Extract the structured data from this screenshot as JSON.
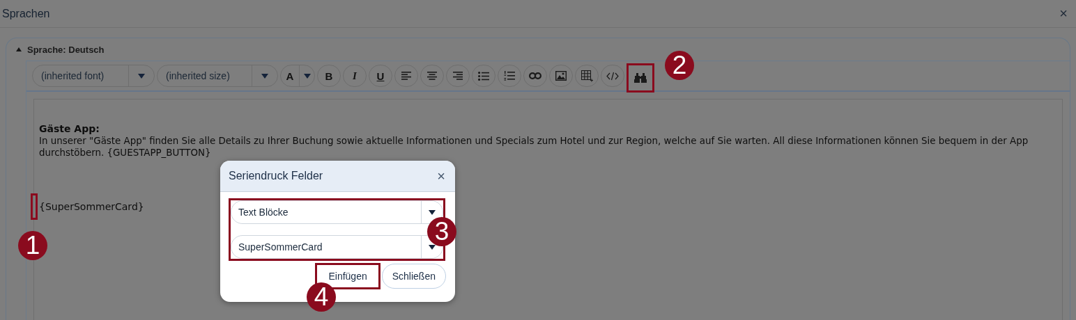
{
  "window": {
    "title": "Sprachen",
    "close": "×"
  },
  "section": {
    "title": "Sprache: Deutsch",
    "expanded": true
  },
  "toolbar": {
    "font": "(inherited font)",
    "size": "(inherited size)",
    "color_label": "A",
    "tools": [
      {
        "kind": "text",
        "label": "B",
        "highlighted": false
      },
      {
        "kind": "text",
        "label": "I",
        "highlighted": false
      },
      {
        "kind": "text",
        "label": "U",
        "highlighted": false
      },
      {
        "kind": "icon",
        "highlighted": false
      },
      {
        "kind": "icon",
        "highlighted": false
      },
      {
        "kind": "icon",
        "highlighted": false
      },
      {
        "kind": "icon",
        "highlighted": false
      },
      {
        "kind": "icon",
        "highlighted": false
      },
      {
        "kind": "icon",
        "highlighted": false
      },
      {
        "kind": "icon",
        "highlighted": false
      },
      {
        "kind": "icon",
        "highlighted": false
      },
      {
        "kind": "icon",
        "highlighted": false
      },
      {
        "kind": "icon",
        "highlighted": true
      }
    ]
  },
  "editor": {
    "heading": "Gäste App:",
    "paragraph": "In unserer \"Gäste App\" finden Sie alle Details zu Ihrer Buchung sowie aktuelle Informationen und Specials zum Hotel und zur Region, welche auf Sie warten. All diese Informationen können Sie bequem in der App durchstöbern. {GUESTAPP_BUTTON}",
    "placeholder_line": "{SuperSommerCard}",
    "cursor_highlighted": true
  },
  "dialog": {
    "title": "Seriendruck Felder",
    "close": "×",
    "fields_highlighted": true,
    "fields": [
      {
        "value": "Text Blöcke"
      },
      {
        "value": "SuperSommerCard"
      }
    ],
    "buttons": [
      {
        "label": "Einfügen",
        "highlighted": true
      },
      {
        "label": "Schließen",
        "highlighted": false
      }
    ]
  },
  "callouts": [
    {
      "label": "1"
    },
    {
      "label": "2"
    },
    {
      "label": "3"
    },
    {
      "label": "4"
    }
  ]
}
